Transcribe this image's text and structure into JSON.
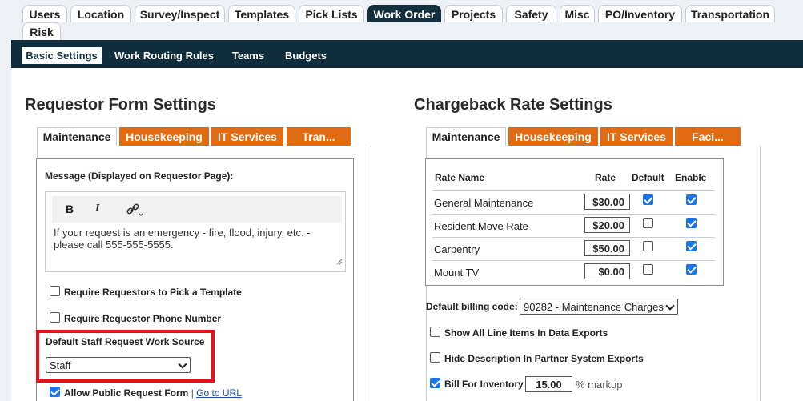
{
  "top_tabs": [
    "Users",
    "Location",
    "Survey/Inspect",
    "Templates",
    "Pick Lists",
    "Work Order",
    "Projects",
    "Safety",
    "Misc",
    "PO/Inventory",
    "Transportation",
    "Risk"
  ],
  "top_tabs_active": "Work Order",
  "subnav": [
    "Basic Settings",
    "Work Routing Rules",
    "Teams",
    "Budgets"
  ],
  "subnav_active": "Basic Settings",
  "requestor": {
    "title": "Requestor Form Settings",
    "tabs": [
      "Maintenance",
      "Housekeeping",
      "IT Services",
      "Tran..."
    ],
    "message_label": "Message (Displayed on Requestor Page):",
    "toolbar": {
      "bold": "B",
      "italic": "I"
    },
    "message_text": "If your request is an emergency - fire, flood, injury, etc. - please call 555-555-5555.",
    "require_template_label": "Require Requestors to Pick a Template",
    "require_phone_label": "Require Requestor Phone Number",
    "work_source_label": "Default Staff Request Work Source",
    "work_source_value": "Staff",
    "allow_public_label": "Allow Public Request Form",
    "separator": "|",
    "go_to_url": "Go to URL"
  },
  "chargeback": {
    "title": "Chargeback Rate Settings",
    "tabs": [
      "Maintenance",
      "Housekeeping",
      "IT Services",
      "Faci..."
    ],
    "columns": [
      "Rate Name",
      "Rate",
      "Default",
      "Enable"
    ],
    "rows": [
      {
        "name": "General Maintenance",
        "rate": "$30.00",
        "default": true,
        "enable": true
      },
      {
        "name": "Resident Move Rate",
        "rate": "$20.00",
        "default": false,
        "enable": true
      },
      {
        "name": "Carpentry",
        "rate": "$50.00",
        "default": false,
        "enable": true
      },
      {
        "name": "Mount TV",
        "rate": "$0.00",
        "default": false,
        "enable": true
      }
    ],
    "billing_label": "Default billing code:",
    "billing_value": "90282 - Maintenance Charges",
    "show_line_items_label": "Show All Line Items In Data Exports",
    "hide_description_label": "Hide Description In Partner System Exports",
    "bill_inventory_label": "Bill For Inventory",
    "markup_value": "15.00",
    "markup_suffix": "% markup"
  },
  "colors": {
    "nav_dark": "#0f2d3c",
    "accent_orange": "#e06b12",
    "highlight_red": "#e8111b",
    "checkbox_blue": "#1a73e8"
  }
}
